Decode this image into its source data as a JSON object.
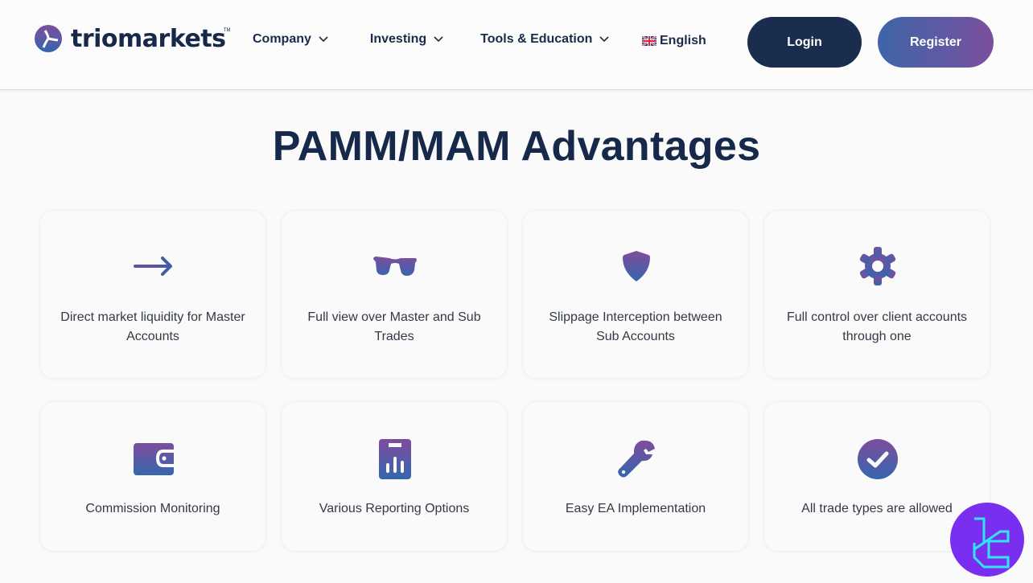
{
  "header": {
    "logo_text": "triomarkets",
    "logo_tm": "TM",
    "nav": [
      {
        "label": "Company"
      },
      {
        "label": "Investing"
      },
      {
        "label": "Tools & Education"
      }
    ],
    "language": "English",
    "login_label": "Login",
    "register_label": "Register"
  },
  "main": {
    "title": "PAMM/MAM Advantages",
    "cards": [
      {
        "icon": "arrow-right-icon",
        "text": "Direct market liquidity for Master Accounts"
      },
      {
        "icon": "sunglasses-icon",
        "text": "Full view over Master and Sub Trades"
      },
      {
        "icon": "shield-icon",
        "text": "Slippage Interception between Sub Accounts"
      },
      {
        "icon": "gear-icon",
        "text": "Full control over client accounts through one"
      },
      {
        "icon": "wallet-icon",
        "text": "Commission Monitoring"
      },
      {
        "icon": "clipboard-chart-icon",
        "text": "Various Reporting Options"
      },
      {
        "icon": "wrench-icon",
        "text": "Easy EA Implementation"
      },
      {
        "icon": "check-circle-icon",
        "text": "All trade types are allowed"
      }
    ]
  },
  "colors": {
    "navy": "#17294a",
    "gradient_start": "#3f64a8",
    "gradient_end": "#7c4f9c",
    "badge": "#7a2ff0",
    "badge_stroke": "#2ee6f5"
  }
}
